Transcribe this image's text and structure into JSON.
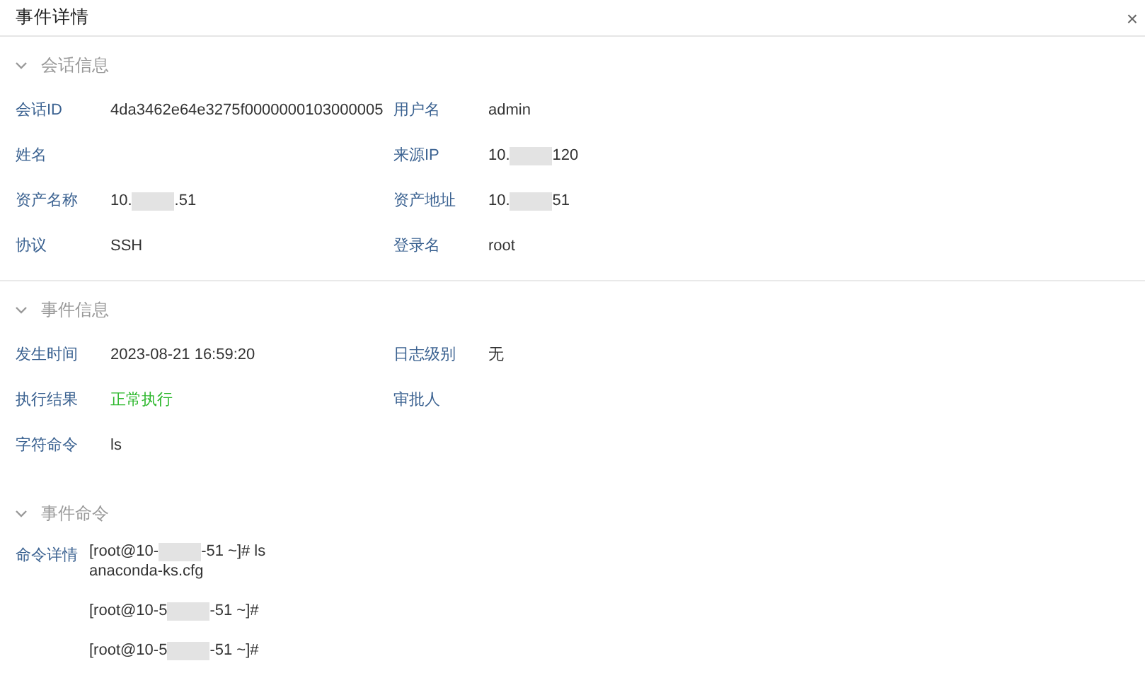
{
  "window": {
    "title": "事件详情",
    "close": "×"
  },
  "sections": [
    {
      "title": "会话信息",
      "expanded": true,
      "fields": [
        {
          "label": "会话ID",
          "parts": [
            {
              "kind": "text",
              "text": "4da3462e64e3275f0000000103000005"
            }
          ]
        },
        {
          "label": "用户名",
          "parts": [
            {
              "kind": "text",
              "text": "admin"
            }
          ]
        },
        {
          "label": "姓名"
        },
        {
          "label": "来源IP",
          "parts": [
            {
              "kind": "text",
              "text": "10."
            },
            {
              "kind": "redacted"
            },
            {
              "kind": "text",
              "text": "120"
            }
          ]
        },
        {
          "label": "资产名称",
          "parts": [
            {
              "kind": "text",
              "text": "10."
            },
            {
              "kind": "redacted"
            },
            {
              "kind": "text",
              "text": ".51"
            }
          ]
        },
        {
          "label": "资产地址",
          "parts": [
            {
              "kind": "text",
              "text": "10."
            },
            {
              "kind": "redacted"
            },
            {
              "kind": "text",
              "text": "51"
            }
          ]
        },
        {
          "label": "协议",
          "parts": [
            {
              "kind": "text",
              "text": "SSH"
            }
          ]
        },
        {
          "label": "登录名",
          "parts": [
            {
              "kind": "text",
              "text": "root"
            }
          ]
        }
      ]
    },
    {
      "title": "事件信息",
      "expanded": true,
      "fields": [
        {
          "label": "发生时间",
          "parts": [
            {
              "kind": "text",
              "text": "2023-08-21 16:59:20"
            }
          ]
        },
        {
          "label": "日志级别",
          "parts": [
            {
              "kind": "text",
              "text": "无"
            }
          ]
        },
        {
          "label": "执行结果",
          "parts": [
            {
              "kind": "text",
              "text": "正常执行",
              "color": "#2eb82e"
            }
          ]
        },
        {
          "label": "审批人"
        },
        {
          "label": "字符命令",
          "parts": [
            {
              "kind": "text",
              "text": "ls"
            }
          ]
        }
      ]
    }
  ],
  "command_section": {
    "title": "事件命令",
    "expanded": true,
    "label": "命令详情",
    "lines": [
      {
        "parts": [
          {
            "kind": "text",
            "text": "[root@10-"
          },
          {
            "kind": "redacted"
          },
          {
            "kind": "text",
            "text": "-51 ~]# ls"
          }
        ]
      },
      {
        "parts": [
          {
            "kind": "text",
            "text": "anaconda-ks.cfg"
          }
        ]
      },
      {
        "gap_before": true,
        "parts": [
          {
            "kind": "text",
            "text": "[root@10-5"
          },
          {
            "kind": "redacted"
          },
          {
            "kind": "text",
            "text": "-51 ~]#"
          }
        ]
      },
      {
        "gap_before": true,
        "parts": [
          {
            "kind": "text",
            "text": "[root@10-5"
          },
          {
            "kind": "redacted"
          },
          {
            "kind": "text",
            "text": "-51 ~]#"
          }
        ]
      }
    ]
  }
}
